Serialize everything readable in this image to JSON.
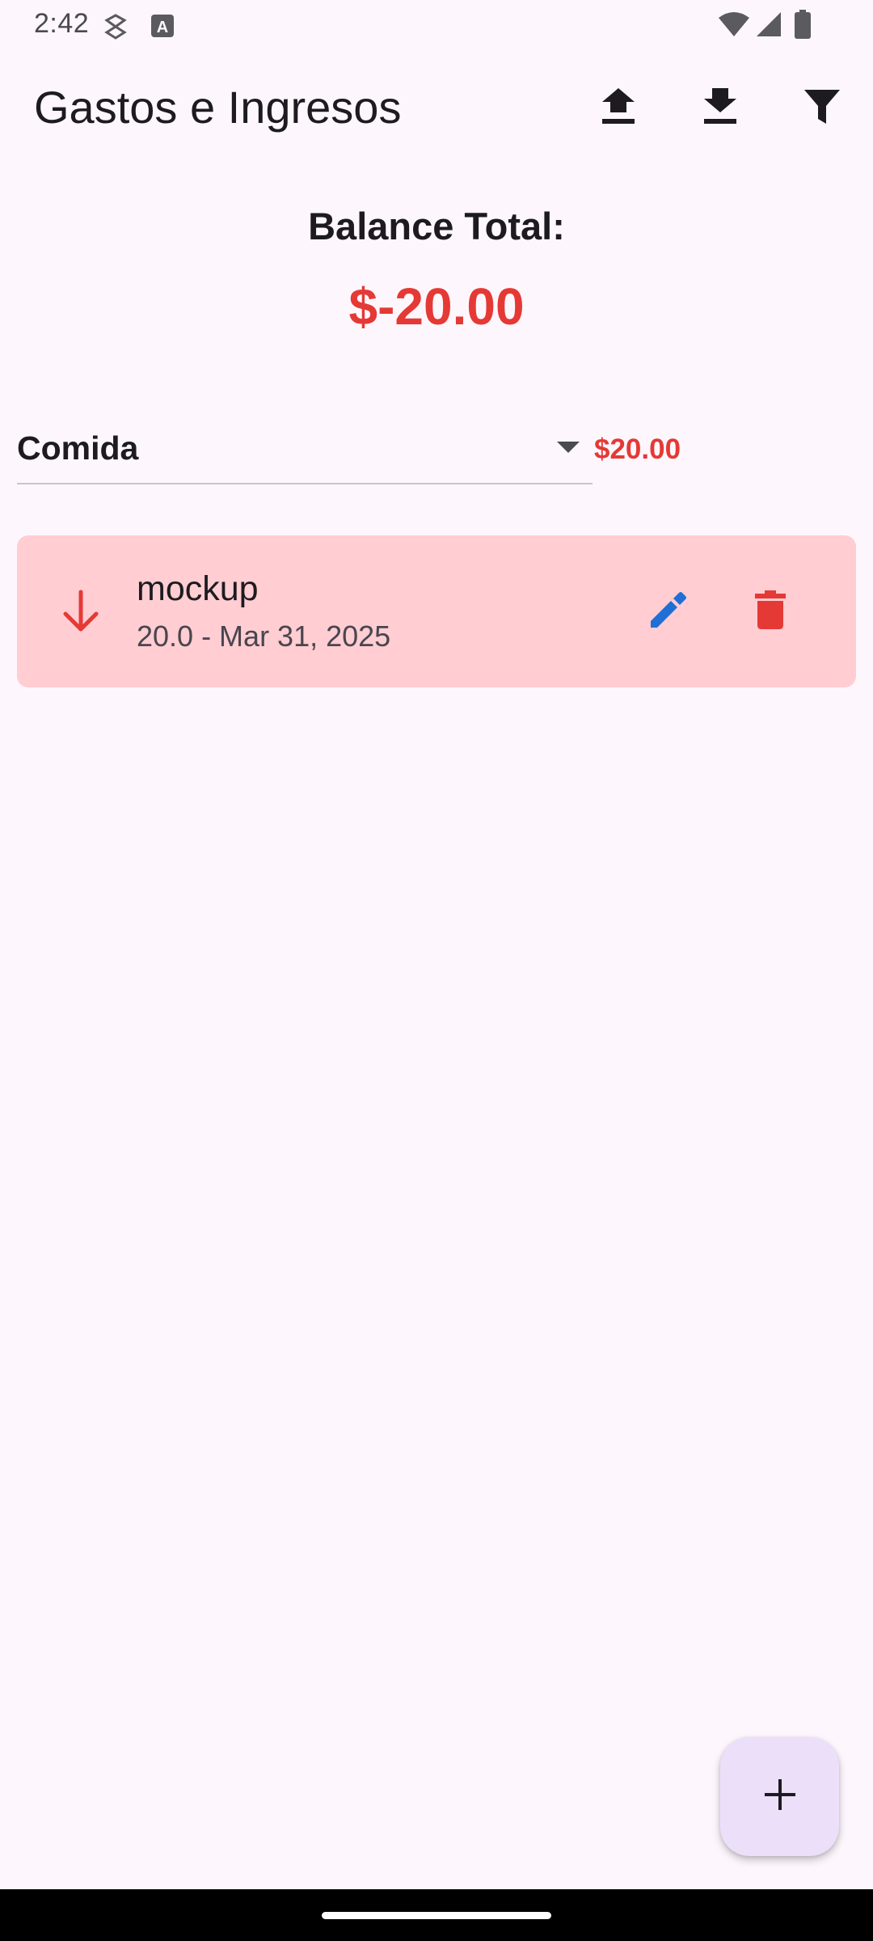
{
  "status_bar": {
    "time": "2:42",
    "icons": [
      "shield-key-icon",
      "keyboard-a-icon",
      "wifi-icon",
      "signal-icon",
      "battery-icon"
    ]
  },
  "app_bar": {
    "title": "Gastos e Ingresos",
    "actions": [
      "upload-icon",
      "download-icon",
      "filter-icon"
    ]
  },
  "balance": {
    "label": "Balance Total:",
    "value": "$-20.00",
    "color": "#e53935"
  },
  "category": {
    "selected": "Comida",
    "total": "$20.00"
  },
  "transactions": [
    {
      "title": "mockup",
      "subtitle": "20.0 - Mar 31, 2025",
      "type": "expense",
      "direction_icon": "arrow-down-icon",
      "card_color": "#ffcdd2",
      "actions": [
        "edit-icon",
        "delete-icon"
      ]
    }
  ],
  "fab": {
    "icon": "add-icon"
  },
  "colors": {
    "background": "#fdf7fd",
    "expense": "#e53935",
    "edit": "#1e6fd6",
    "fab": "#ebdff9"
  }
}
